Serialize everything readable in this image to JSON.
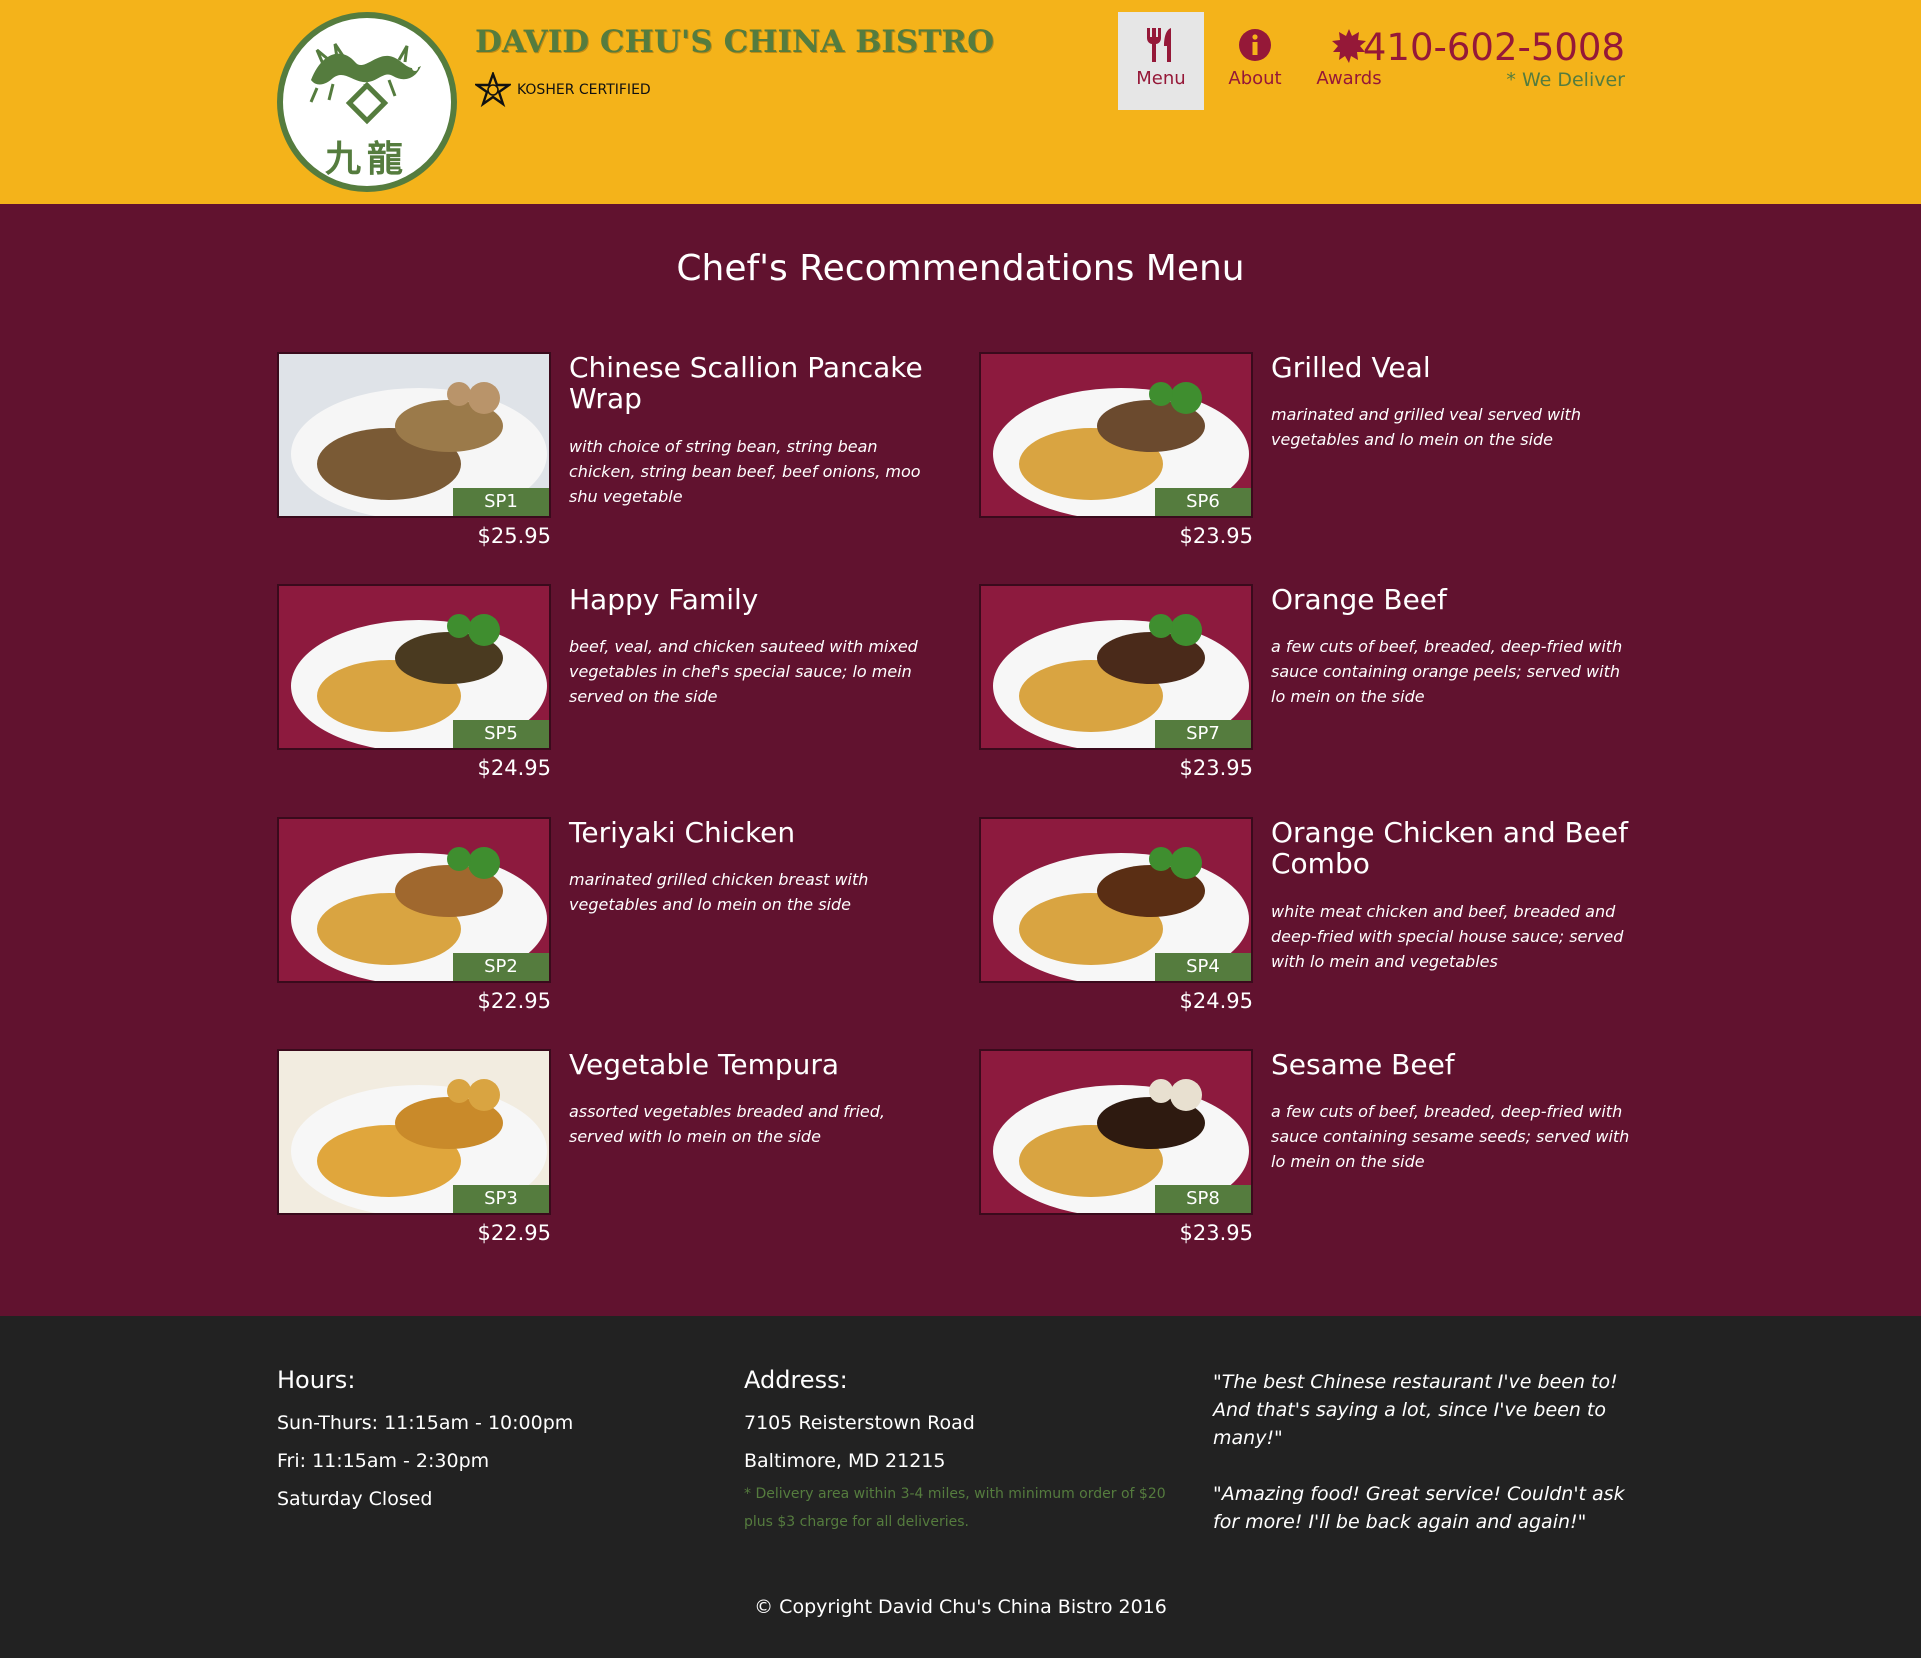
{
  "header": {
    "logo_alt": "九龍",
    "brand_name": "DAVID CHU'S CHINA BISTRO",
    "kosher_label": "KOSHER CERTIFIED",
    "nav": [
      {
        "label": "Menu",
        "icon": "fork-knife-icon",
        "active": true
      },
      {
        "label": "About",
        "icon": "info-icon",
        "active": false
      },
      {
        "label": "Awards",
        "icon": "certificate-icon",
        "active": false
      }
    ],
    "phone": "410-602-5008",
    "deliver_note": "* We Deliver"
  },
  "main": {
    "title": "Chef's Recommendations Menu",
    "items": [
      {
        "code": "SP1",
        "name": "Chinese Scallion Pancake Wrap",
        "desc": "with choice of string bean, string bean chicken, string bean beef, beef onions, moo shu vegetable",
        "price": "$25.95"
      },
      {
        "code": "SP6",
        "name": "Grilled Veal",
        "desc": "marinated and grilled veal served with vegetables and lo mein on the side",
        "price": "$23.95"
      },
      {
        "code": "SP5",
        "name": "Happy Family",
        "desc": "beef, veal, and chicken sauteed with mixed vegetables in chef's special sauce; lo mein served on the side",
        "price": "$24.95"
      },
      {
        "code": "SP7",
        "name": "Orange Beef",
        "desc": "a few cuts of beef, breaded, deep-fried with sauce containing orange peels; served with lo mein on the side",
        "price": "$23.95"
      },
      {
        "code": "SP2",
        "name": "Teriyaki Chicken",
        "desc": "marinated grilled chicken breast with vegetables and lo mein on the side",
        "price": "$22.95"
      },
      {
        "code": "SP4",
        "name": "Orange Chicken and Beef Combo",
        "desc": "white meat chicken and beef, breaded and deep-fried with special house sauce; served with lo mein and vegetables",
        "price": "$24.95"
      },
      {
        "code": "SP3",
        "name": "Vegetable Tempura",
        "desc": "assorted vegetables breaded and fried, served with lo mein on the side",
        "price": "$22.95"
      },
      {
        "code": "SP8",
        "name": "Sesame Beef",
        "desc": "a few cuts of beef, breaded, deep-fried with sauce containing sesame seeds; served with lo mein on the side",
        "price": "$23.95"
      }
    ]
  },
  "footer": {
    "hours_heading": "Hours:",
    "hours": [
      "Sun-Thurs: 11:15am - 10:00pm",
      "Fri: 11:15am - 2:30pm",
      "Saturday Closed"
    ],
    "address_heading": "Address:",
    "address": [
      "7105 Reisterstown Road",
      "Baltimore, MD 21215"
    ],
    "delivery_note": "* Delivery area within 3-4 miles, with minimum order of $20 plus $3 charge for all deliveries.",
    "quotes": [
      "\"The best Chinese restaurant I've been to! And that's saying a lot, since I've been to many!\"",
      "\"Amazing food! Great service! Couldn't ask for more! I'll be back again and again!\""
    ],
    "copyright": "© Copyright David Chu's China Bistro 2016"
  },
  "colors": {
    "header_bg": "#f4b31a",
    "main_bg": "#61122f",
    "accent_green": "#557c3e",
    "accent_maroon": "#951838",
    "footer_bg": "#222222"
  }
}
